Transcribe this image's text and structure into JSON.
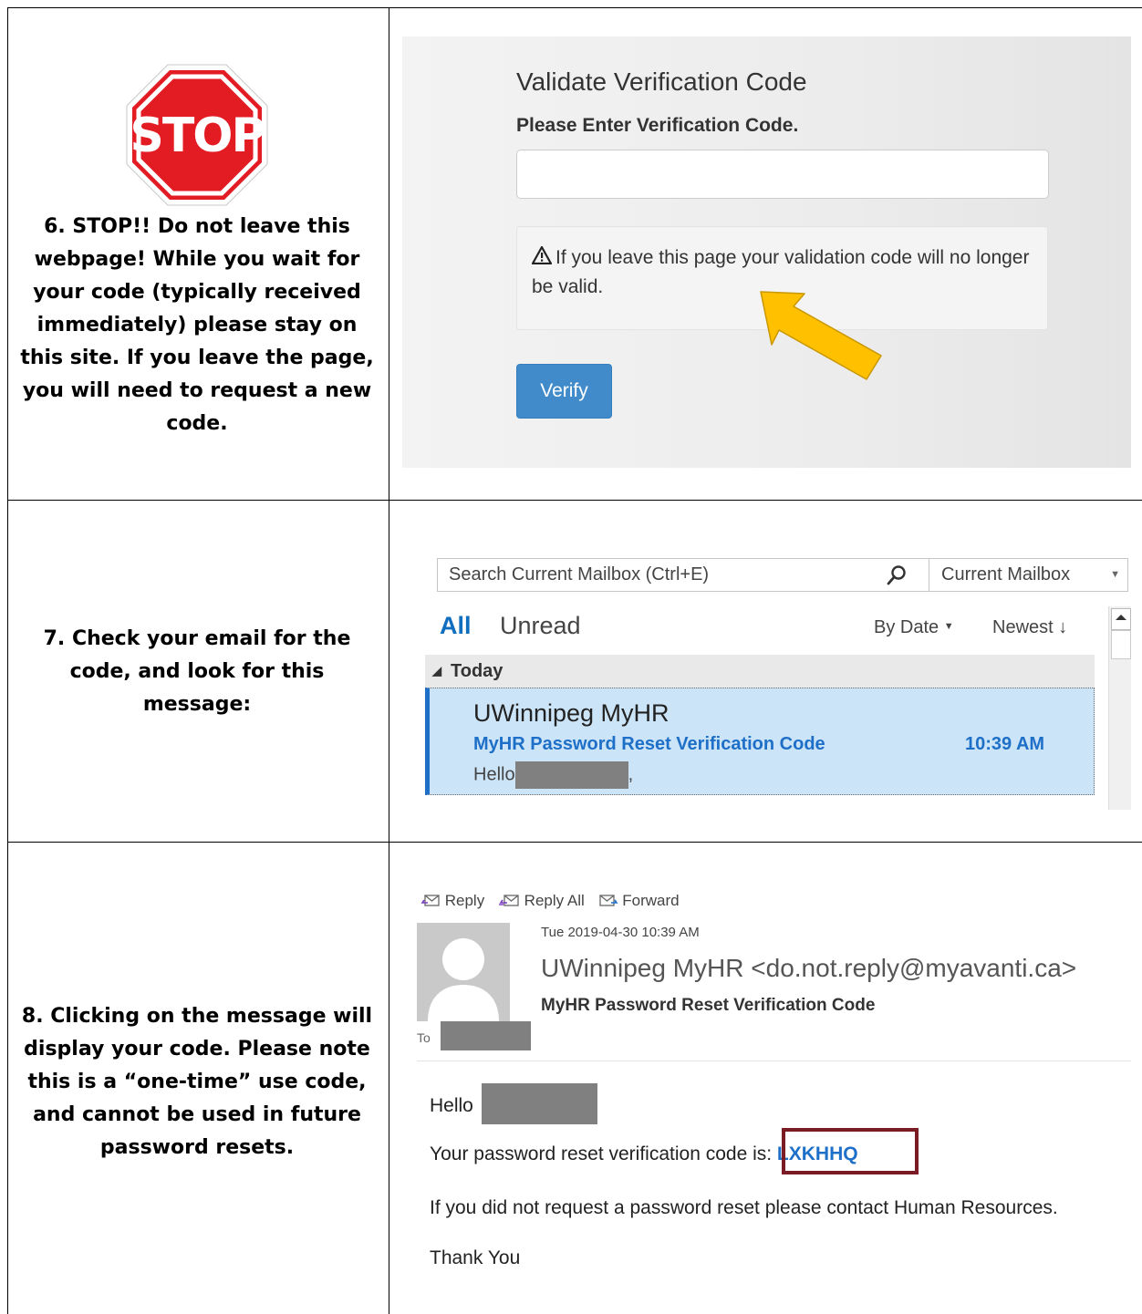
{
  "steps": {
    "step6": "6. STOP!! Do not leave this webpage! While you wait for your code (typically received immediately) please stay on this site. If you leave the page, you will need to request a new code.",
    "step7": "7. Check your email for the code, and look for this message:",
    "step8": "8. Clicking on the message will display your code. Please note this is a “one-time” use code, and cannot be used in future password resets."
  },
  "stop_sign": {
    "text": "STOP",
    "color": "#e31b23"
  },
  "validate": {
    "title": "Validate Verification Code",
    "label": "Please Enter Verification Code.",
    "input_value": "",
    "warning": "If you leave this page your validation code will no longer be valid.",
    "verify_button": "Verify",
    "button_color": "#428bca",
    "arrow_color": "#ffc000"
  },
  "mailbox": {
    "search_placeholder": "Search Current Mailbox (Ctrl+E)",
    "scope": "Current Mailbox",
    "filter_all": "All",
    "filter_unread": "Unread",
    "sort_by": "By Date",
    "sort_order": "Newest",
    "group": "Today",
    "message": {
      "sender": "UWinnipeg MyHR",
      "subject": "MyHR Password Reset Verification Code",
      "time": "10:39 AM",
      "preview_prefix": "Hello",
      "preview_suffix": ","
    },
    "selection_color": "#cce4f7",
    "accent_color": "#1e6fc8"
  },
  "email": {
    "actions": [
      "Reply",
      "Reply All",
      "Forward"
    ],
    "date": "Tue 2019-04-30 10:39 AM",
    "from": "UWinnipeg MyHR <do.not.reply@myavanti.ca>",
    "subject": "MyHR Password Reset Verification Code",
    "to_label": "To",
    "hello": "Hello",
    "hello_suffix": ",",
    "code_prefix": "Your password reset verification code is: ",
    "code": "LXKHHQ",
    "contact": "If you did not request a password reset please contact Human Resources.",
    "thanks": "Thank You",
    "highlight_color": "#7b1b24"
  }
}
